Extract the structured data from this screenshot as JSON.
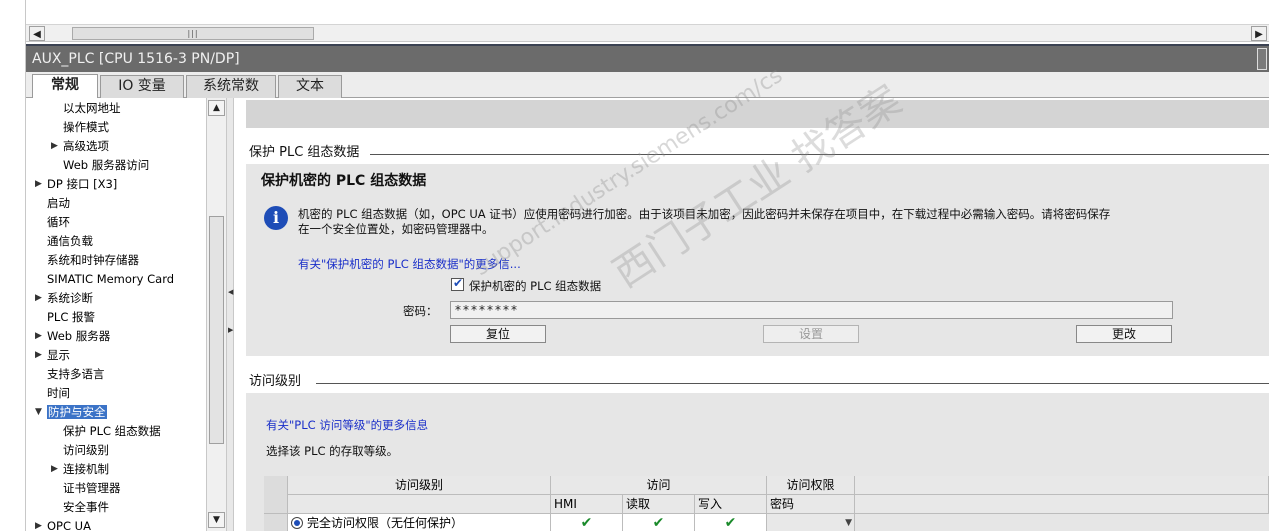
{
  "window": {
    "title": "AUX_PLC [CPU 1516-3 PN/DP]"
  },
  "tabs": [
    {
      "label": "常规",
      "active": true
    },
    {
      "label": "IO 变量",
      "active": false
    },
    {
      "label": "系统常数",
      "active": false
    },
    {
      "label": "文本",
      "active": false
    }
  ],
  "tree": {
    "items": [
      {
        "label": "以太网地址",
        "expandable": false
      },
      {
        "label": "操作模式",
        "expandable": false
      },
      {
        "label": "高级选项",
        "expandable": true
      },
      {
        "label": "Web 服务器访问",
        "expandable": false
      },
      {
        "label": "DP 接口 [X3]",
        "expandable": true
      },
      {
        "label": "启动",
        "expandable": false
      },
      {
        "label": "循环",
        "expandable": false
      },
      {
        "label": "通信负载",
        "expandable": false
      },
      {
        "label": "系统和时钟存储器",
        "expandable": false
      },
      {
        "label": "SIMATIC Memory Card",
        "expandable": false
      },
      {
        "label": "系统诊断",
        "expandable": true
      },
      {
        "label": "PLC 报警",
        "expandable": false
      },
      {
        "label": "Web 服务器",
        "expandable": true
      },
      {
        "label": "显示",
        "expandable": true
      },
      {
        "label": "支持多语言",
        "expandable": false
      },
      {
        "label": "时间",
        "expandable": false
      },
      {
        "label": "防护与安全",
        "expandable": true,
        "expanded": true,
        "selected": true
      },
      {
        "label": "保护 PLC 组态数据",
        "expandable": false
      },
      {
        "label": "访问级别",
        "expandable": false
      },
      {
        "label": "连接机制",
        "expandable": true
      },
      {
        "label": "证书管理器",
        "expandable": false
      },
      {
        "label": "安全事件",
        "expandable": false
      },
      {
        "label": "OPC UA",
        "expandable": true
      }
    ]
  },
  "protect": {
    "section_title": "保护 PLC 组态数据",
    "panel_title": "保护机密的 PLC 组态数据",
    "info_text": "机密的 PLC 组态数据（如，OPC UA 证书）应使用密码进行加密。由于该项目未加密，因此密码并未保存在项目中，在下载过程中必需输入密码。请将密码保存在一个安全位置处，如密码管理器中。",
    "more_link": "有关\"保护机密的 PLC 组态数据\"的更多信...",
    "checkbox_label": "保护机密的 PLC 组态数据",
    "checkbox_checked": true,
    "password_label": "密码：",
    "password_value": "********",
    "reset_button": "复位",
    "set_button": "设置",
    "change_button": "更改"
  },
  "access": {
    "section_title": "访问级别",
    "more_link": "有关\"PLC 访问等级\"的更多信息",
    "select_text": "选择该 PLC 的存取等级。",
    "table": {
      "col_level": "访问级别",
      "col_access": "访问",
      "col_perm": "访问权限",
      "sub_hmi": "HMI",
      "sub_read": "读取",
      "sub_write": "写入",
      "sub_password": "密码",
      "rows": [
        {
          "level": "完全访问权限（无任何保护）",
          "hmi": "✔",
          "read": "✔",
          "write": "✔",
          "password": ""
        }
      ]
    }
  },
  "watermark": {
    "line1": "support.industry.siemens.com/cs",
    "line2": "西门子工业 找答案"
  },
  "colors": {
    "titlebar": "#6b6b6b",
    "link": "#1a2fc9",
    "selected": "#3b73c7",
    "info_icon": "#1e4db7",
    "check_green": "#1a8a2a"
  }
}
